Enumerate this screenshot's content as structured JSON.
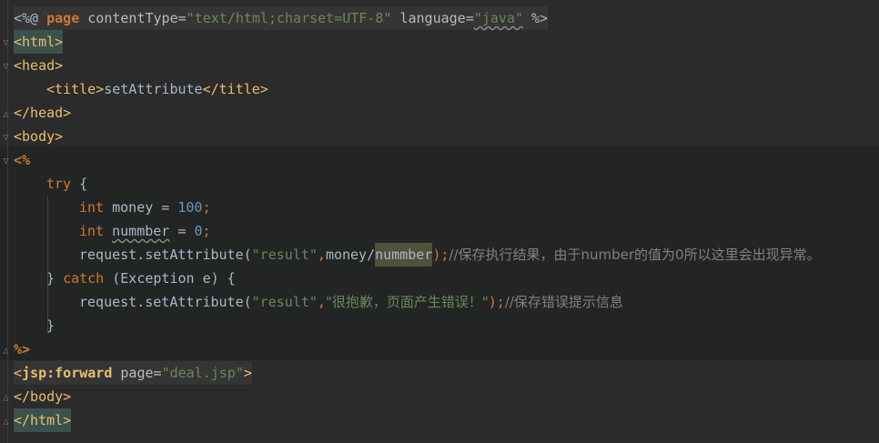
{
  "lines": {
    "l1": {
      "open": "<%@ ",
      "kw": "page",
      "a1": " contentType=",
      "v1": "\"text/html;charset=UTF-8\"",
      "a2": " language=",
      "v2": "\"java\"",
      "close": " %>"
    },
    "l2": {
      "t": "<html>"
    },
    "l3": {
      "t": "<head>"
    },
    "l4": {
      "o": "<title>",
      "text": "setAttribute",
      "c": "</title>"
    },
    "l5": {
      "t": "</head>"
    },
    "l6": {
      "t": "<body>"
    },
    "l7": {
      "t": "<%"
    },
    "l8": {
      "kw": "try",
      "rest": " {"
    },
    "l9": {
      "type": "int",
      "name": " money = ",
      "num": "100",
      "semi": ";"
    },
    "l10": {
      "type": "int",
      "name": "nummber",
      "mid": " = ",
      "num": "0",
      "semi": ";"
    },
    "l11": {
      "call": "request.setAttribute(",
      "s": "\"result\"",
      "comma": ",",
      "arg1": "money/",
      "arg2": "nummber",
      "end": ");",
      "cmt": "//保存执行结果，由于number的值为0所以这里会出现异常。"
    },
    "l12": {
      "b": "} ",
      "kw": "catch",
      "rest": " (Exception e) {"
    },
    "l13": {
      "call": "request.setAttribute(",
      "s1": "\"result\"",
      "comma": ",",
      "s2": "\"很抱歉，页面产生错误！\"",
      "end": ");",
      "cmt": "//保存错误提示信息"
    },
    "l14": {
      "t": "}"
    },
    "l15": {
      "t": "%>"
    },
    "l16": {
      "o": "<",
      "tag": "jsp:forward",
      "a": " page=",
      "v": "\"deal.jsp\"",
      "c": ">"
    },
    "l17": {
      "t": "</body>"
    },
    "l18": {
      "t": "</html>"
    }
  }
}
